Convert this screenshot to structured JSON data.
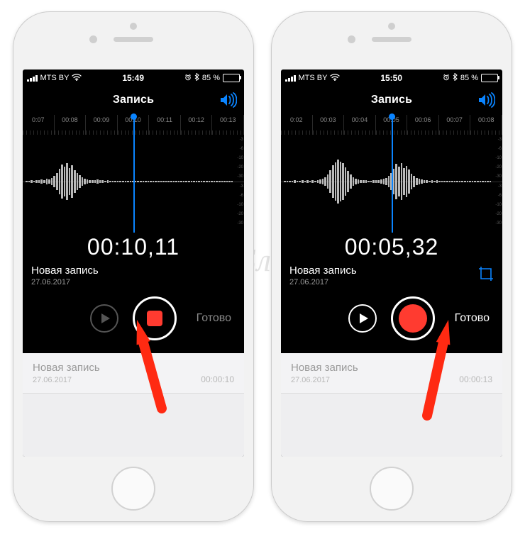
{
  "watermark": "ЯБлык",
  "phones": [
    {
      "statusbar": {
        "carrier": "MTS BY",
        "wifi": true,
        "time": "15:49",
        "alarm": true,
        "bt": true,
        "battery_pct": "85 %"
      },
      "nav_title": "Запись",
      "ruler": [
        "0:07",
        "00:08",
        "00:09",
        "00:10",
        "00:11",
        "00:12",
        "00:13"
      ],
      "playhead_pct": 50,
      "timer": "00:10,11",
      "rec_title": "Новая запись",
      "rec_date": "27.06.2017",
      "show_crop": false,
      "record_shape": "square",
      "play_enabled": false,
      "done_label": "Готово",
      "done_enabled": false,
      "list_title": "Новая запись",
      "list_date": "27.06.2017",
      "list_duration": "00:00:10",
      "arrow_target": "record",
      "wave": [
        3,
        2,
        4,
        3,
        5,
        4,
        6,
        5,
        8,
        7,
        12,
        18,
        28,
        42,
        55,
        48,
        60,
        44,
        52,
        36,
        28,
        20,
        14,
        10,
        6,
        5,
        4,
        5,
        6,
        5,
        4,
        3,
        4,
        3,
        2,
        3,
        2,
        3,
        2,
        3,
        2,
        2,
        2,
        2,
        3,
        2,
        3,
        2,
        3,
        2,
        3,
        2,
        3,
        2,
        3,
        2,
        2,
        2,
        2,
        2,
        3,
        2,
        3,
        2,
        3,
        2,
        2,
        2,
        2,
        2,
        2,
        2,
        2,
        2,
        2,
        2,
        2,
        2,
        2,
        2,
        2,
        2
      ],
      "db_marks": [
        "-3",
        "-6",
        "-10",
        "-20",
        "-30",
        "-3",
        "-6",
        "-10",
        "-20",
        "-30"
      ]
    },
    {
      "statusbar": {
        "carrier": "MTS BY",
        "wifi": true,
        "time": "15:50",
        "alarm": true,
        "bt": true,
        "battery_pct": "85 %"
      },
      "nav_title": "Запись",
      "ruler": [
        "0:02",
        "00:03",
        "00:04",
        "00:05",
        "00:06",
        "00:07",
        "00:08"
      ],
      "playhead_pct": 50,
      "timer": "00:05,32",
      "rec_title": "Новая запись",
      "rec_date": "27.06.2017",
      "show_crop": true,
      "record_shape": "round",
      "play_enabled": true,
      "done_label": "Готово",
      "done_enabled": true,
      "list_title": "Новая запись",
      "list_date": "27.06.2017",
      "list_duration": "00:00:13",
      "arrow_target": "done",
      "wave": [
        2,
        2,
        3,
        2,
        4,
        3,
        3,
        4,
        3,
        4,
        3,
        4,
        3,
        4,
        6,
        8,
        14,
        22,
        36,
        52,
        62,
        70,
        64,
        58,
        46,
        34,
        22,
        14,
        10,
        7,
        5,
        4,
        4,
        3,
        3,
        4,
        4,
        5,
        6,
        8,
        12,
        18,
        28,
        42,
        56,
        48,
        60,
        44,
        50,
        38,
        26,
        18,
        12,
        8,
        6,
        5,
        4,
        3,
        4,
        3,
        4,
        3,
        3,
        3,
        3,
        2,
        2,
        2,
        2,
        2,
        2,
        2,
        2,
        2,
        2,
        2,
        2,
        2,
        2,
        2,
        2,
        2
      ],
      "db_marks": [
        "-3",
        "-6",
        "-10",
        "-20",
        "-30",
        "-3",
        "-6",
        "-10",
        "-20",
        "-30"
      ]
    }
  ]
}
